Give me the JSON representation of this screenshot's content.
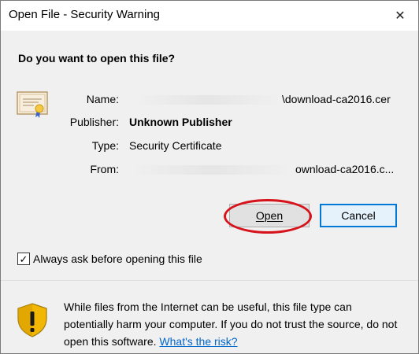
{
  "window": {
    "title": "Open File - Security Warning",
    "close_glyph": "✕"
  },
  "dialog": {
    "question": "Do you want to open this file?",
    "fields": {
      "name_label": "Name:",
      "name_value": "\\download-ca2016.cer",
      "publisher_label": "Publisher:",
      "publisher_value": "Unknown Publisher",
      "type_label": "Type:",
      "type_value": "Security Certificate",
      "from_label": "From:",
      "from_value": "ownload-ca2016.c..."
    },
    "buttons": {
      "open_label": "Open",
      "cancel_label": "Cancel"
    },
    "checkbox": {
      "label": "Always ask before opening this file",
      "checked": true,
      "check_glyph": "✓"
    },
    "warning": {
      "text": "While files from the Internet can be useful, this file type can potentially harm your computer. If you do not trust the source, do not open this software.",
      "link_text": "What's the risk?"
    }
  },
  "icons": {
    "certificate": "certificate-icon",
    "shield": "security-shield-icon",
    "close": "close-icon"
  },
  "colors": {
    "accent": "#0078d7",
    "annotation": "#d6131b",
    "link": "#0066cc",
    "shield_gold": "#f2b705"
  }
}
